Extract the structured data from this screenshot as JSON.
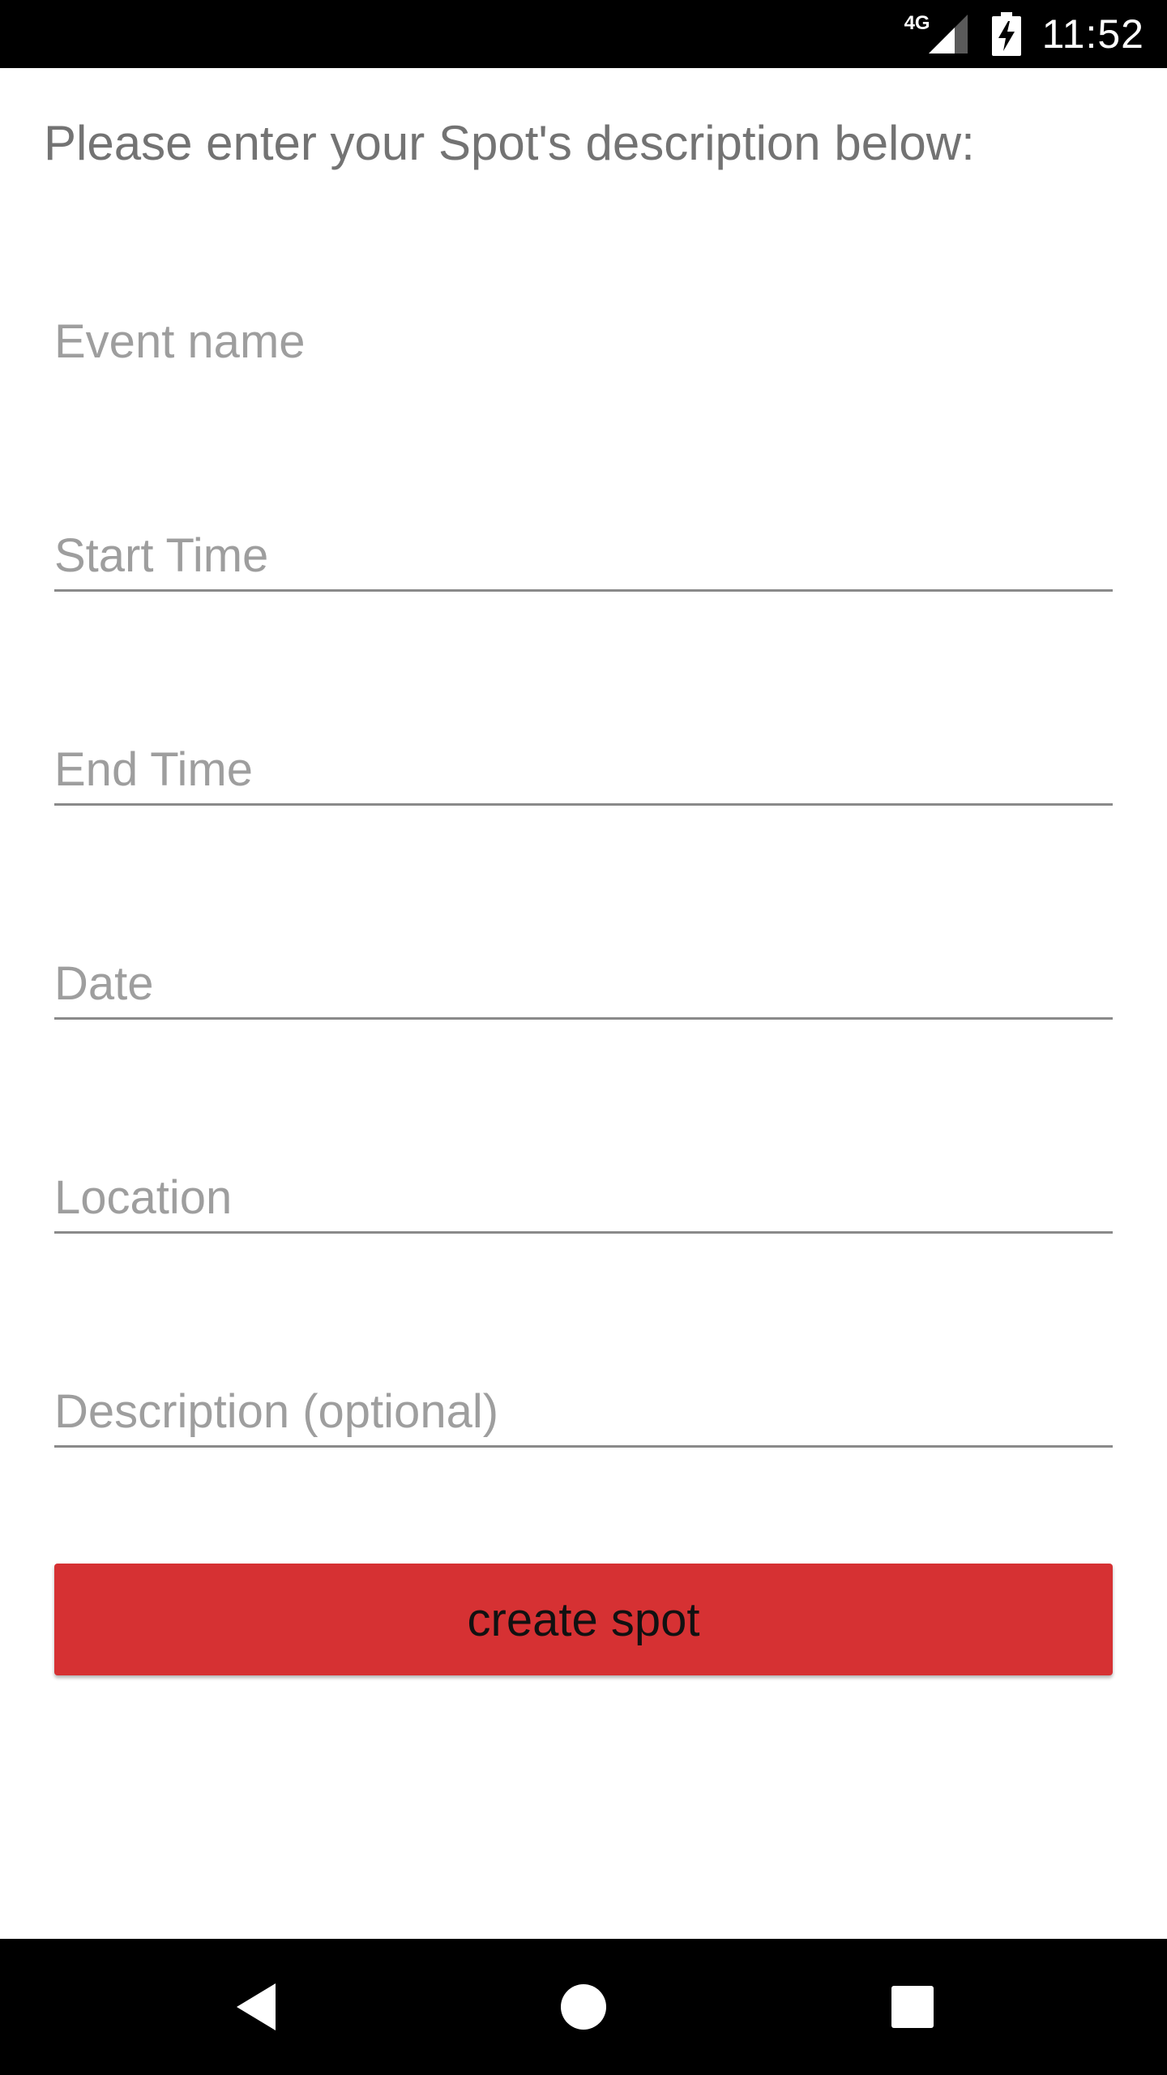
{
  "status_bar": {
    "network_type": "4G",
    "time": "11:52",
    "icons": [
      "signal-icon",
      "battery-charging-icon"
    ]
  },
  "form": {
    "heading": "Please enter your Spot's description below:",
    "fields": [
      {
        "placeholder": "Event name",
        "value": ""
      },
      {
        "placeholder": "Start Time",
        "value": ""
      },
      {
        "placeholder": "End Time",
        "value": ""
      },
      {
        "placeholder": "Date",
        "value": ""
      },
      {
        "placeholder": "Location",
        "value": ""
      },
      {
        "placeholder": "Description (optional)",
        "value": ""
      }
    ],
    "submit_label": "create spot"
  },
  "nav_bar": {
    "icons": [
      "back-icon",
      "home-icon",
      "recents-icon"
    ]
  },
  "colors": {
    "button": "#d63133",
    "heading_text": "#737373",
    "placeholder": "#9e9e9e",
    "underline": "#8a8a8a"
  }
}
